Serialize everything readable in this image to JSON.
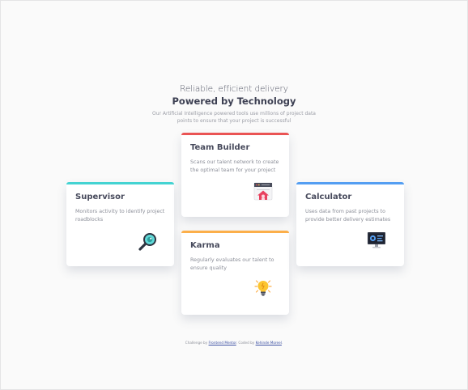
{
  "header": {
    "subtitle": "Reliable, efficient delivery",
    "title": "Powered by Technology",
    "intro": "Our Artificial Intelligence powered tools use millions of project data points to ensure that your project is successful"
  },
  "cards": {
    "supervisor": {
      "title": "Supervisor",
      "description": "Monitors activity to identify project roadblocks",
      "icon": "magnifier-icon",
      "accent": "#44d3d2"
    },
    "team_builder": {
      "title": "Team Builder",
      "description": "Scans our talent network to create the optimal team for your project",
      "icon": "team-builder-icon",
      "accent": "#ea5454"
    },
    "karma": {
      "title": "Karma",
      "description": "Regularly evaluates our talent to ensure quality",
      "icon": "lightbulb-icon",
      "accent": "#fcaf4a"
    },
    "calculator": {
      "title": "Calculator",
      "description": "Uses data from past projects to provide better delivery estimates",
      "icon": "monitor-icon",
      "accent": "#549ef2"
    }
  },
  "footer": {
    "prefix": "Challenge by",
    "challenge_link": "Frontend Mentor",
    "middle": ". Coded by",
    "author_link": "Kehinde Moreel",
    "suffix": "."
  }
}
